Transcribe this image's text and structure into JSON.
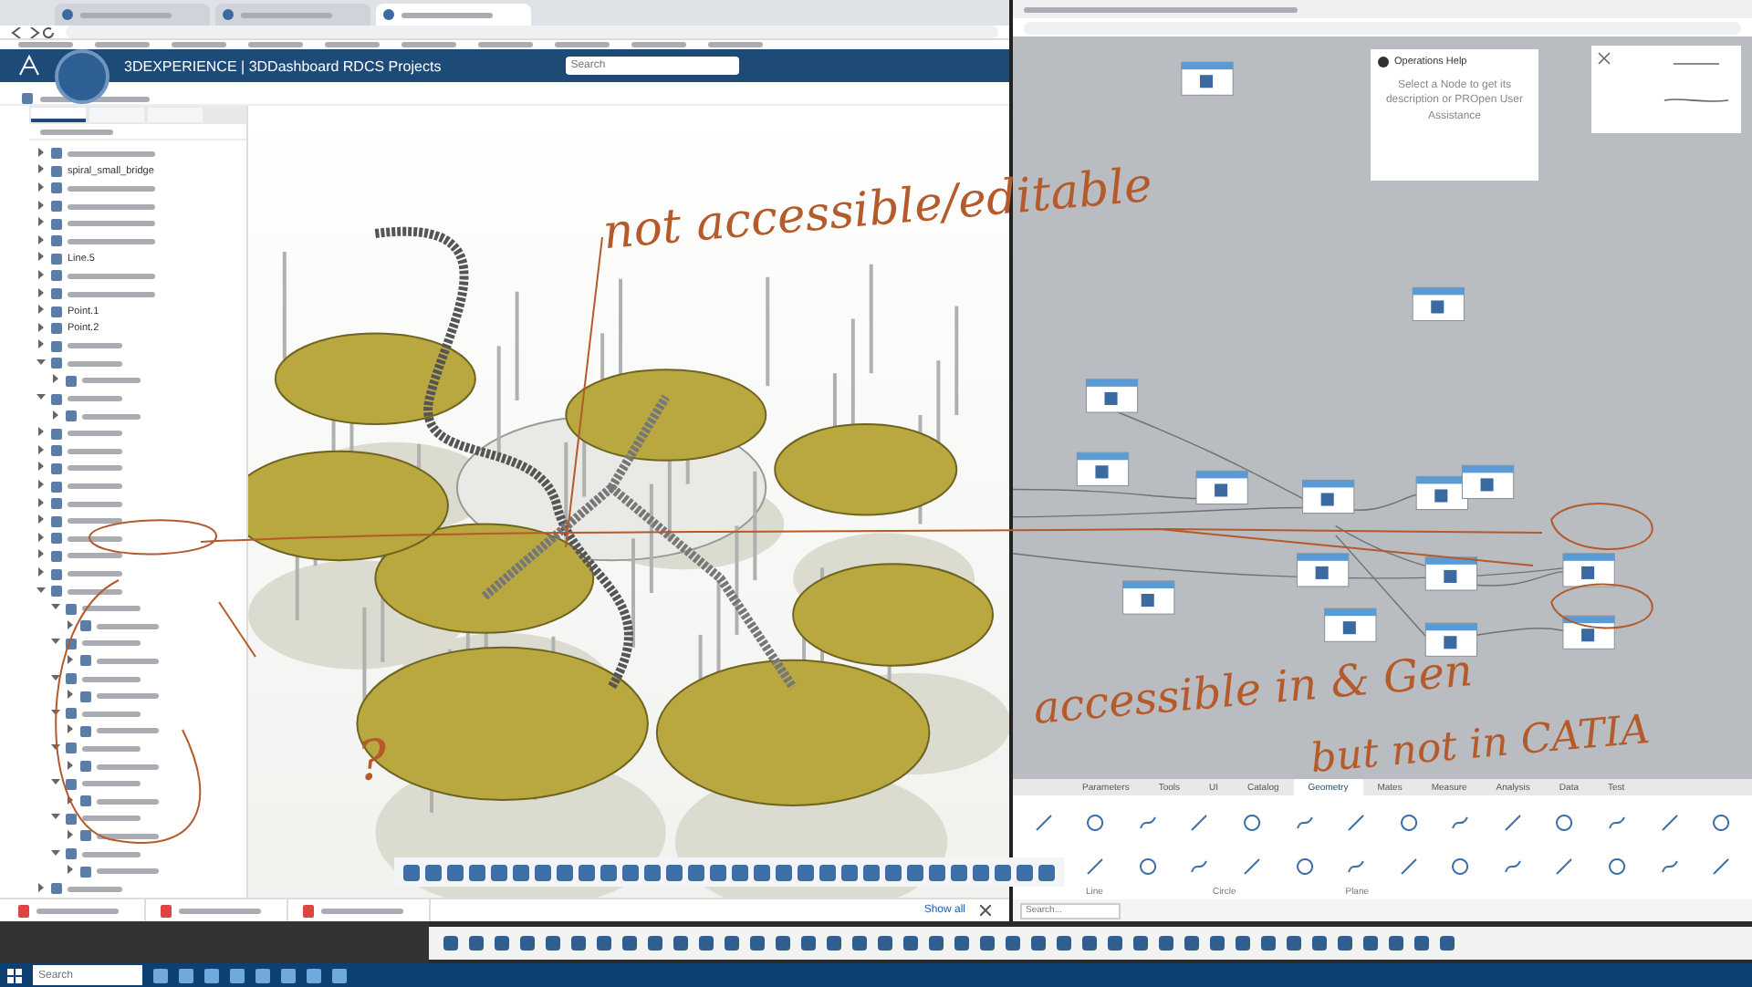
{
  "left_window": {
    "tabs": [
      {
        "selected": false
      },
      {
        "selected": false
      },
      {
        "selected": true
      }
    ],
    "app_header": {
      "title": "3DEXPERIENCE | 3DDashboard RDCS Projects",
      "search": {
        "placeholder": "Search"
      }
    },
    "tree": {
      "tabs": [
        {
          "selected": true
        },
        {
          "selected": false
        },
        {
          "selected": false
        }
      ],
      "items": [
        {
          "kind": "blurred",
          "expanded": false
        },
        {
          "kind": "text",
          "label": "spiral_small_bridge",
          "expanded": false
        },
        {
          "kind": "blurred",
          "expanded": false
        },
        {
          "kind": "blurred",
          "expanded": false
        },
        {
          "kind": "blurred",
          "expanded": false
        },
        {
          "kind": "blurred",
          "expanded": false
        },
        {
          "kind": "text",
          "label": "Line.5",
          "expanded": false
        },
        {
          "kind": "blurred",
          "expanded": false
        },
        {
          "kind": "blurred",
          "expanded": false
        },
        {
          "kind": "text",
          "label": "Point.1",
          "expanded": false
        },
        {
          "kind": "text",
          "label": "Point.2",
          "expanded": false
        },
        {
          "kind": "blurred",
          "expanded": false
        },
        {
          "kind": "blurred",
          "expanded": true,
          "children": [
            {
              "kind": "blurred",
              "expanded": false
            }
          ]
        },
        {
          "kind": "blurred",
          "expanded": true,
          "children": [
            {
              "kind": "blurred",
              "expanded": false
            }
          ]
        },
        {
          "kind": "blurred",
          "expanded": false
        },
        {
          "kind": "blurred",
          "expanded": false
        },
        {
          "kind": "blurred",
          "expanded": false
        },
        {
          "kind": "blurred",
          "expanded": false
        },
        {
          "kind": "blurred",
          "expanded": false
        },
        {
          "kind": "blurred",
          "expanded": false
        },
        {
          "kind": "blurred",
          "expanded": false
        },
        {
          "kind": "blurred",
          "expanded": false
        },
        {
          "kind": "blurred",
          "expanded": false
        },
        {
          "kind": "blurred",
          "expanded": true,
          "children": [
            {
              "kind": "blurred",
              "expanded": true,
              "children": [
                {
                  "kind": "blurred",
                  "expanded": false
                }
              ]
            },
            {
              "kind": "blurred",
              "expanded": true,
              "children": [
                {
                  "kind": "blurred",
                  "expanded": false
                }
              ]
            },
            {
              "kind": "blurred",
              "expanded": true,
              "children": [
                {
                  "kind": "blurred",
                  "expanded": false
                }
              ]
            },
            {
              "kind": "blurred",
              "expanded": true,
              "children": [
                {
                  "kind": "blurred",
                  "expanded": false
                }
              ]
            },
            {
              "kind": "blurred",
              "expanded": true,
              "children": [
                {
                  "kind": "blurred",
                  "expanded": false
                }
              ]
            },
            {
              "kind": "blurred",
              "expanded": true,
              "children": [
                {
                  "kind": "blurred",
                  "expanded": false
                }
              ]
            },
            {
              "kind": "blurred",
              "expanded": true,
              "children": [
                {
                  "kind": "blurred",
                  "expanded": false
                }
              ]
            },
            {
              "kind": "blurred",
              "expanded": true,
              "children": [
                {
                  "kind": "blurred",
                  "expanded": false
                }
              ]
            }
          ]
        },
        {
          "kind": "blurred",
          "expanded": false
        }
      ]
    },
    "downloads": {
      "link": "Show all"
    }
  },
  "right_window": {
    "help": {
      "title": "Operations Help",
      "text": "Select a Node to get its description or PROpen User Assistance"
    },
    "ribbon": {
      "tabs": [
        {
          "label": "Parameters",
          "selected": false
        },
        {
          "label": "Tools",
          "selected": false
        },
        {
          "label": "UI",
          "selected": false
        },
        {
          "label": "Catalog",
          "selected": false
        },
        {
          "label": "Geometry",
          "selected": true
        },
        {
          "label": "Mates",
          "selected": false
        },
        {
          "label": "Measure",
          "selected": false
        },
        {
          "label": "Analysis",
          "selected": false
        },
        {
          "label": "Data",
          "selected": false
        },
        {
          "label": "Test",
          "selected": false
        }
      ],
      "groups": [
        "Line",
        "Circle",
        "Plane"
      ],
      "search": {
        "placeholder": "Search..."
      }
    }
  },
  "annotations": [
    {
      "text": "not accessible/editable"
    },
    {
      "text": "?"
    },
    {
      "text": "accessible in & Gen"
    },
    {
      "text": "but not in CATIA"
    }
  ],
  "taskbar": {
    "search": {
      "placeholder": "Search"
    }
  }
}
